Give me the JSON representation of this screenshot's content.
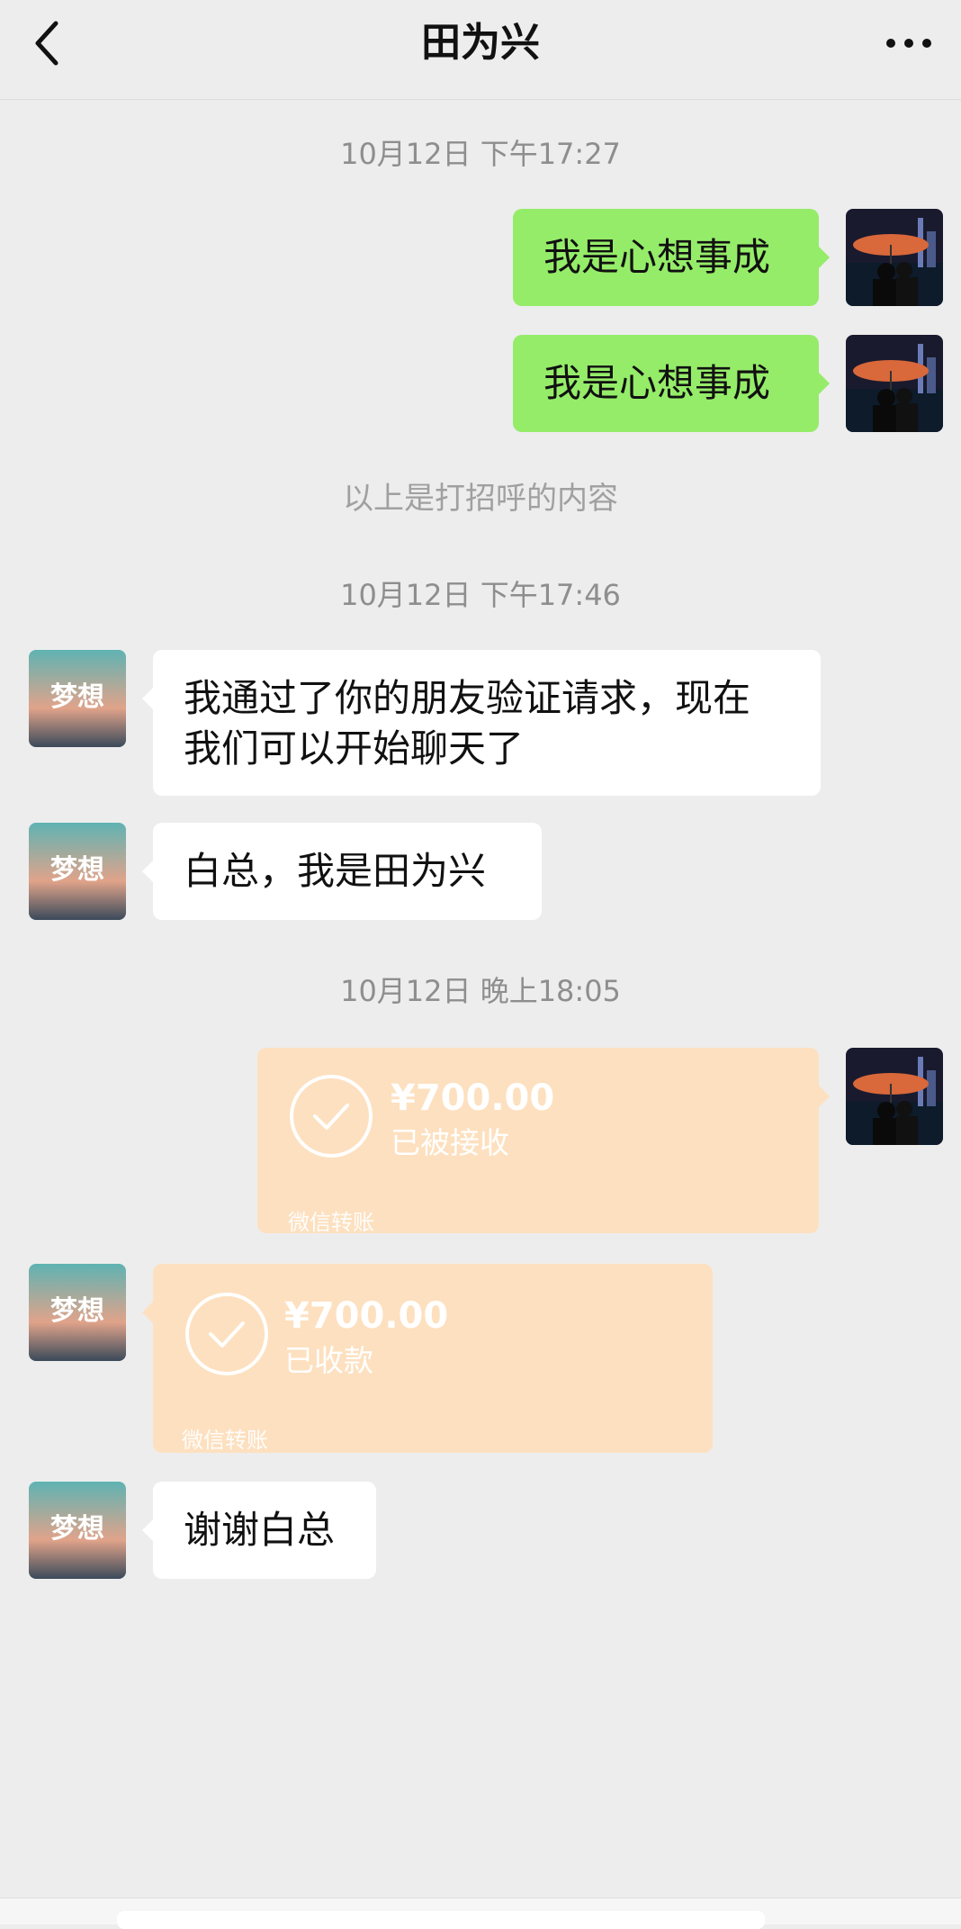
{
  "header": {
    "title": "田为兴",
    "back_icon": "chevron-left-icon",
    "more_icon": "more-dots-icon"
  },
  "messages": {
    "time1": "10月12日 下午17:27",
    "sent1": "我是心想事成",
    "sent2": "我是心想事成",
    "system": "以上是打招呼的内容",
    "time2": "10月12日 下午17:46",
    "recv1_line1": "我通过了你的朋友验证请求，现在",
    "recv1_line2": "我们可以开始聊天了",
    "recv2": "白总，我是田为兴",
    "time3": "10月12日 晚上18:05",
    "transfer_sent": {
      "amount": "¥700.00",
      "status": "已被接收",
      "label": "微信转账"
    },
    "transfer_recv": {
      "amount": "¥700.00",
      "status": "已收款",
      "label": "微信转账"
    },
    "recv3": "谢谢白总"
  },
  "colors": {
    "background": "#ededed",
    "sent_bubble": "#95ec69",
    "recv_bubble": "#ffffff",
    "transfer_bubble": "#fde0bf"
  }
}
